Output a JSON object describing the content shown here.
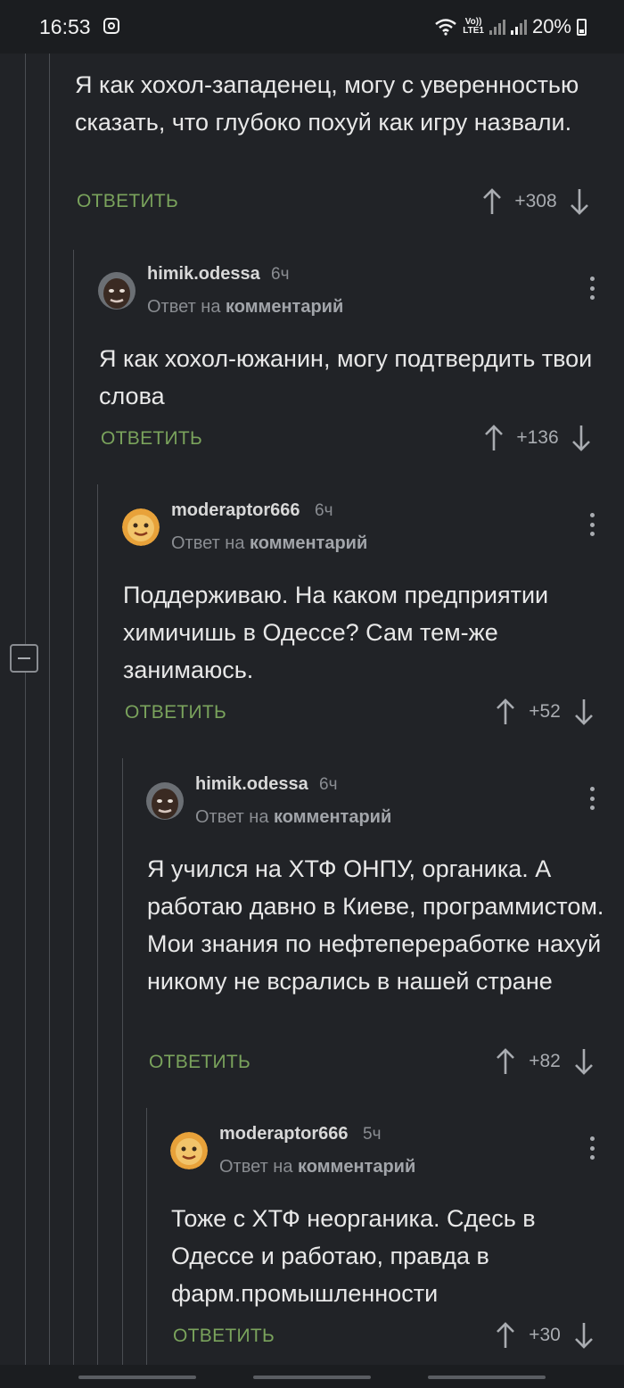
{
  "status_bar": {
    "time": "16:53",
    "network": "Vo)) LTE1",
    "battery": "20%"
  },
  "ui": {
    "reply_label": "ОТВЕТИТЬ",
    "reply_to_prefix": "Ответ на",
    "reply_to_link": "комментарий"
  },
  "comments": [
    {
      "text": "Я как хохол-западенец, могу с уверенностью сказать, что глубоко похуй как игру назвали.",
      "score": "+308"
    },
    {
      "username": "himik.odessa",
      "time": "6ч",
      "text": "Я как хохол-южанин, могу подтвердить твои слова",
      "score": "+136",
      "avatar": "dark-face-avatar"
    },
    {
      "username": "moderaptor666",
      "time": "6ч",
      "text": "Поддерживаю. На каком предприятии химичишь в Одессе? Сам тем-же занимаюсь.",
      "score": "+52",
      "avatar": "orange-smiley-avatar"
    },
    {
      "username": "himik.odessa",
      "time": "6ч",
      "text": "Я учился на ХТФ ОНПУ, органика. А работаю давно в Киеве, программистом. Мои знания по нефтепереработке нахуй никому не всрались в нашей стране",
      "score": "+82",
      "avatar": "dark-face-avatar"
    },
    {
      "username": "moderaptor666",
      "time": "5ч",
      "text": "Тоже с ХТФ неорганика. Сдесь в Одессе и работаю, правда в фарм.промышленности",
      "score": "+30",
      "avatar": "orange-smiley-avatar"
    }
  ],
  "colors": {
    "background": "#212327",
    "accent_green": "#7aa35c",
    "muted": "#8a8d92"
  }
}
